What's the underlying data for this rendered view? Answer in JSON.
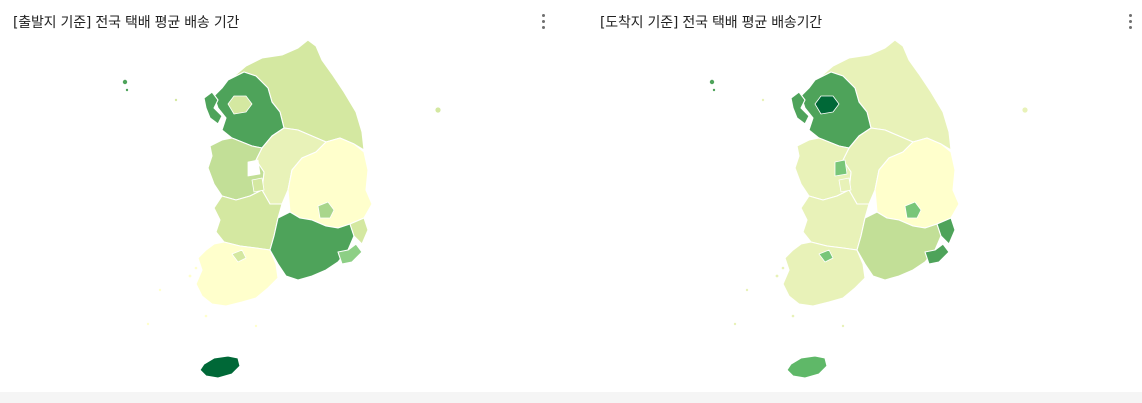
{
  "palette": {
    "darkest": "#006837",
    "dark": "#31a354",
    "medium_dark": "#4ea35a",
    "medium": "#78c679",
    "light_medium": "#addd8e",
    "light": "#d4e8a1",
    "lighter": "#e8f2b8",
    "lightest": "#ffffcc"
  },
  "panels": [
    {
      "title": "[출발지 기준] 전국 택배 평균 배송 기간",
      "menu_icon": "more-vert-icon",
      "regions": {
        "seoul": "#d4e8a1",
        "incheon": "#4ea35a",
        "gyeonggi": "#4ea35a",
        "gangwon": "#d4e8a1",
        "chungbuk": "#e8f2b8",
        "chungnam": "#c2df97",
        "sejong": "#ffffff",
        "daejeon": "#d4e8a1",
        "gyeongbuk": "#ffffcc",
        "daegu": "#a9d68c",
        "jeonbuk": "#d4e8a1",
        "gwangju": "#d4e8a1",
        "jeonnam": "#ffffcc",
        "gyeongnam": "#4ea35a",
        "ulsan": "#d4e8a1",
        "busan": "#8dcf85",
        "jeju": "#006837"
      }
    },
    {
      "title": "[도착지 기준] 전국 택배 평균 배송기간",
      "menu_icon": "more-vert-icon",
      "regions": {
        "seoul": "#006837",
        "incheon": "#4ea35a",
        "gyeonggi": "#4ea35a",
        "gangwon": "#e8f2b8",
        "chungbuk": "#e8f2b8",
        "chungnam": "#e8f2b8",
        "sejong": "#78c679",
        "daejeon": "#e8f2b8",
        "gyeongbuk": "#ffffcc",
        "daegu": "#78c679",
        "jeonbuk": "#e8f2b8",
        "gwangju": "#78c679",
        "jeonnam": "#e8f2b8",
        "gyeongnam": "#c2df97",
        "ulsan": "#4ea35a",
        "busan": "#4ea35a",
        "jeju": "#5fb868"
      }
    }
  ]
}
